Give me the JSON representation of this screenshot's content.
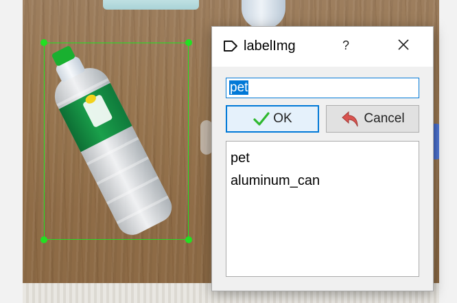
{
  "dialog": {
    "title": "labelImg",
    "help_label": "?",
    "icons": {
      "app": "label-tag-icon",
      "close": "close-icon",
      "ok": "checkmark-icon",
      "cancel": "undo-arrow-icon"
    },
    "label_input": {
      "value": "pet"
    },
    "ok_label": "OK",
    "cancel_label": "Cancel",
    "label_list": [
      {
        "label": "pet"
      },
      {
        "label": "aluminum_can"
      }
    ]
  },
  "canvas": {
    "annotation": {
      "label": "pet",
      "color": "#22e022"
    }
  },
  "colors": {
    "selection": "#0078d7",
    "bbox": "#22e022",
    "ok_check": "#2eb82e",
    "cancel_arrow": "#d9534f"
  }
}
